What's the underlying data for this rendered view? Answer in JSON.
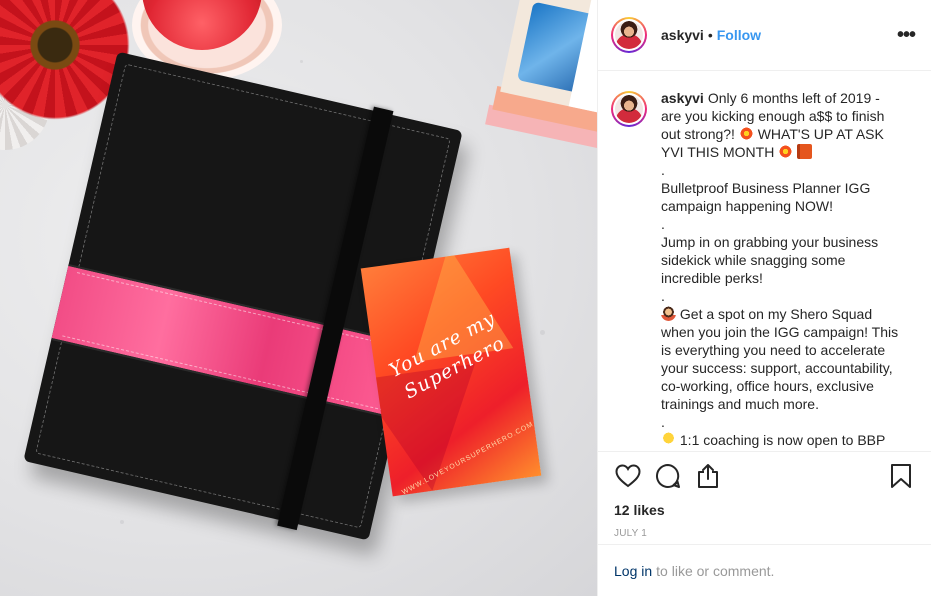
{
  "header": {
    "username": "askyvi",
    "separator": "•",
    "follow_label": "Follow",
    "more_label": "•••"
  },
  "caption": {
    "username": "askyvi",
    "lines": [
      "Only 6 months left of 2019 - are you kicking enough a$$ to finish out strong?!",
      "WHAT'S UP AT ASK YVI THIS MONTH",
      ".",
      "Bulletproof Business Planner IGG campaign happening NOW!",
      ".",
      "Jump in on grabbing your business sidekick while snagging some incredible perks!",
      ".",
      "Get a spot on my Shero Squad when you join the IGG campaign! This is everything you need to accelerate your success: support, accountability, co-working, office hours, exclusive trainings and much more.",
      ".",
      "1:1 coaching is now open to BBP"
    ],
    "emojis": [
      "collision",
      "orange-book",
      "woman-technologist",
      "light-bulb"
    ]
  },
  "photo": {
    "card_text": "You are my Superhero",
    "card_url": "WWW.LOVEYOURSUPERHERO.COM"
  },
  "actions": {
    "likes": "12 likes",
    "date": "JULY 1"
  },
  "login": {
    "link": "Log in",
    "rest": "to like or comment."
  },
  "colors": {
    "link_blue": "#3897f0",
    "login_blue": "#003569",
    "planner_band": "#f24d86"
  },
  "icons": [
    "heart-icon",
    "comment-icon",
    "share-icon",
    "bookmark-icon",
    "more-options-icon"
  ]
}
